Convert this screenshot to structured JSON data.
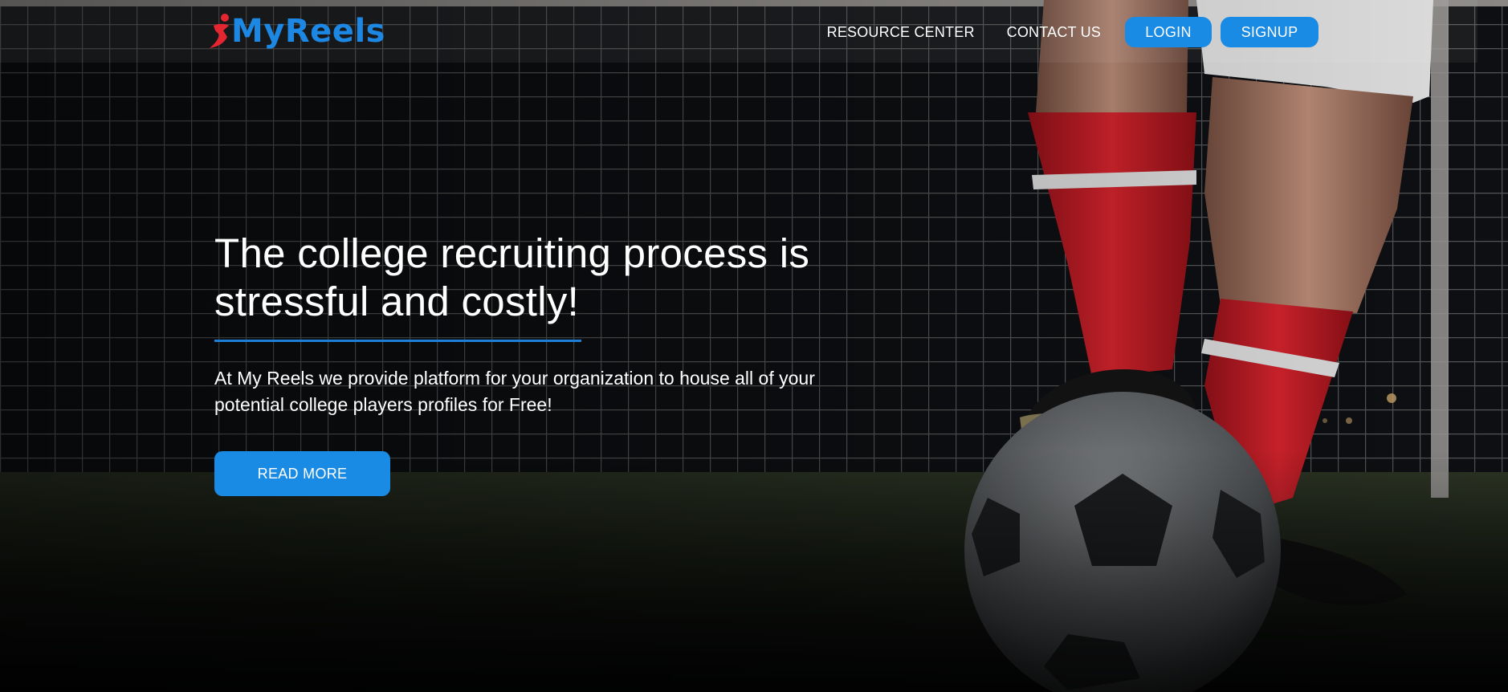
{
  "header": {
    "logo_text": "MyReels",
    "nav": {
      "resource_center": "RESOURCE CENTER",
      "contact_us": "CONTACT US",
      "login": "LOGIN",
      "signup": "SIGNUP"
    }
  },
  "hero": {
    "headline_line1": "The college recruiting process is",
    "headline_line2": "stressful and costly!",
    "subtext_line1": "At My Reels we provide platform for your organization to house all of your",
    "subtext_line2": "potential college players profiles for Free!",
    "cta_label": "READ MORE",
    "background_image": "soccer-player-foot-on-ball-icon"
  },
  "colors": {
    "accent": "#1a8be4",
    "logo_red": "#e3262f",
    "sock_red": "#c9202a"
  }
}
